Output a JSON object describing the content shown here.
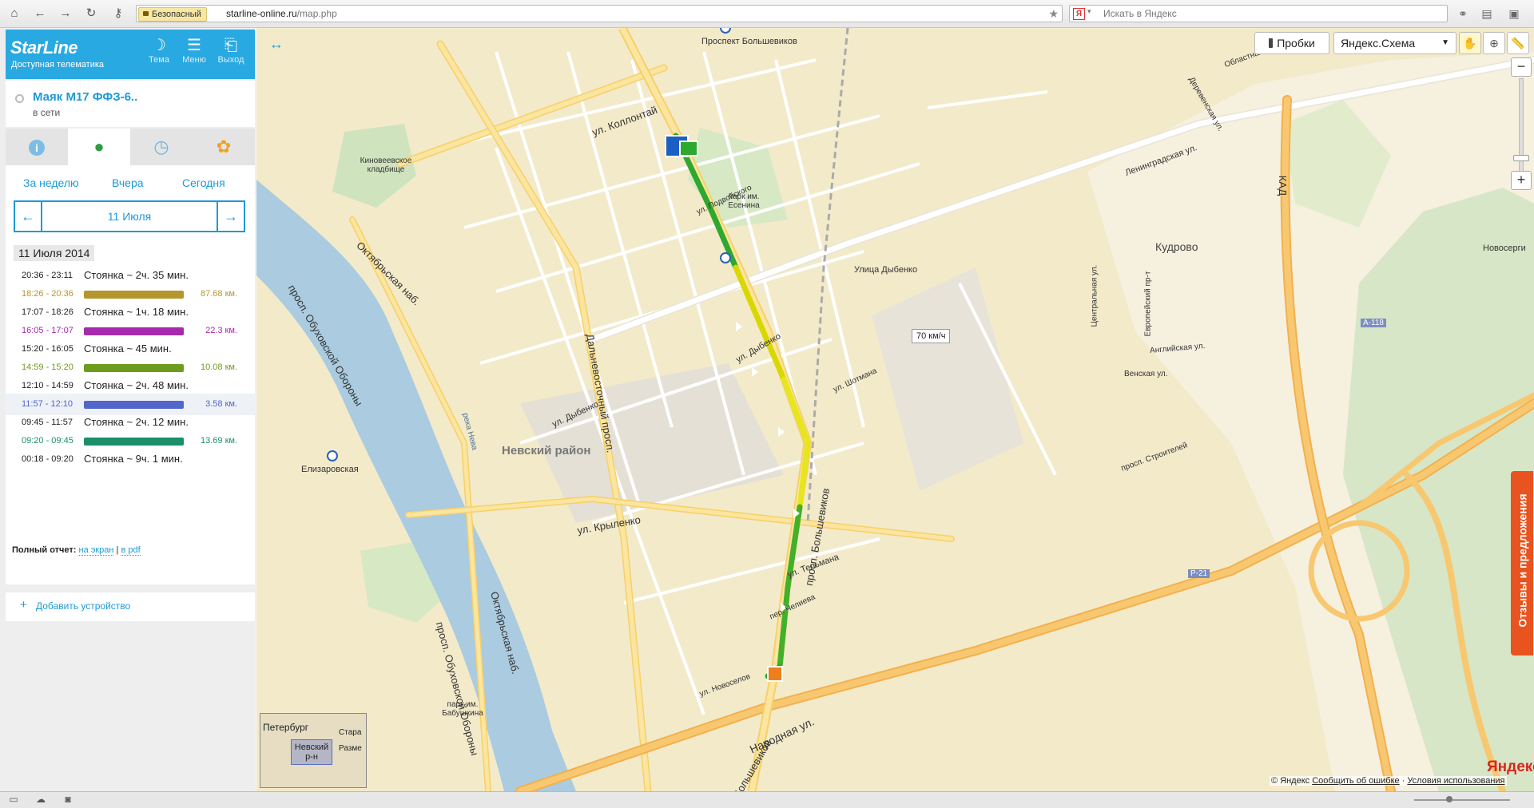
{
  "browser": {
    "secure_label": "Безопасный",
    "url_host": "starline-online.ru",
    "url_path": "/map.php",
    "search_placeholder": "Искать в Яндекс",
    "ya_badge": "Я"
  },
  "header": {
    "logo": "StarLine",
    "tagline": "Доступная телематика",
    "buttons": [
      {
        "label": "Тема",
        "icon": "moon-icon"
      },
      {
        "label": "Меню",
        "icon": "menu-icon"
      },
      {
        "label": "Выход",
        "icon": "exit-icon"
      }
    ]
  },
  "device": {
    "name": "Маяк М17 ФФЗ-6..",
    "status": "в сети"
  },
  "tabs": [
    {
      "name": "info",
      "icon": "info-icon",
      "active": false
    },
    {
      "name": "map",
      "icon": "location-pin-icon",
      "active": true
    },
    {
      "name": "history",
      "icon": "clock-icon",
      "active": false
    },
    {
      "name": "settings",
      "icon": "settings-icon",
      "active": false
    }
  ],
  "period": {
    "week": "За неделю",
    "yesterday": "Вчера",
    "today": "Сегодня",
    "prev_arrow": "←",
    "next_arrow": "→",
    "current_date": "11 Июля"
  },
  "history": {
    "date_title": "11 Июля 2014",
    "trips": [
      {
        "time": "20:36 - 23:11",
        "type": "stop",
        "label": "Стоянка ~ 2ч. 35 мин."
      },
      {
        "time": "18:26 - 20:36",
        "type": "drive",
        "km": "87.68 км.",
        "color": "#b5962d"
      },
      {
        "time": "17:07 - 18:26",
        "type": "stop",
        "label": "Стоянка ~ 1ч. 18 мин."
      },
      {
        "time": "16:05 - 17:07",
        "type": "drive",
        "km": "22.3 км.",
        "color": "#a62aad"
      },
      {
        "time": "15:20 - 16:05",
        "type": "stop",
        "label": "Стоянка ~ 45 мин."
      },
      {
        "time": "14:59 - 15:20",
        "type": "drive",
        "km": "10.08 км.",
        "color": "#6f9b1f"
      },
      {
        "time": "12:10 - 14:59",
        "type": "stop",
        "label": "Стоянка ~ 2ч. 48 мин."
      },
      {
        "time": "11:57 - 12:10",
        "type": "drive",
        "km": "3.58 км.",
        "color": "#5366cc"
      },
      {
        "time": "09:45 - 11:57",
        "type": "stop",
        "label": "Стоянка ~ 2ч. 12 мин."
      },
      {
        "time": "09:20 - 09:45",
        "type": "drive",
        "km": "13.69 км.",
        "color": "#1a8f6a"
      },
      {
        "time": "00:18 - 09:20",
        "type": "stop",
        "label": "Стоянка ~ 9ч. 1 мин."
      }
    ],
    "report_label": "Полный отчет:",
    "report_screen": "на экран",
    "report_sep": "|",
    "report_pdf": "в pdf"
  },
  "add_device": {
    "icon": "+",
    "label": "Добавить устройство"
  },
  "map": {
    "expand_icon": "↔",
    "traffic_button": "Пробки",
    "layer_select": "Яндекс.Схема",
    "speed_label": "70 км/ч",
    "district": "Невский район",
    "labels": {
      "kudrovo": "Кудрово",
      "novosergi": "Новосерги",
      "bolshevikov_station": "Проспект Большевиков",
      "dybenko_station": "Улица Дыбенко",
      "elizarovskaya": "Елизаровская",
      "cemetery": "Киновеевское кладбище",
      "park_esenina": "парк им. Есенина",
      "park_babushkina": "парк им. Бабушкина",
      "kollontai": "ул. Коллонтай",
      "dybenko_st": "ул. Дыбенко",
      "dybenko_st2": "ул. Дыбенко",
      "krylenko": "ул. Крыленко",
      "telmana": "ул. Тельмана",
      "narodnaya": "Народная ул.",
      "dalnevostochny": "Дальневосточный просп.",
      "oktyabrskaya": "Октябрьская наб.",
      "oktyabrskaya2": "Октябрьская наб.",
      "obukhovskoy": "просп. Обуховской Обороны",
      "obukhovskoy2": "просп. Обуховской Обороны",
      "bolshevikov_prosp": "просп. Большевиков",
      "bolshevikov_short": "Большевиков",
      "leningradskaya": "Ленинградская ул.",
      "kad": "КАД",
      "a118": "А-118",
      "p21": "Р-21",
      "neva": "река Нева",
      "podvoiskogo": "ул. Подвойского",
      "shotmana": "ул. Шотмана",
      "novoselov": "ул. Новоселов",
      "chelieva": "пер. Челиева",
      "tsentralnaya": "Центральная ул.",
      "venskaya": "Венская ул.",
      "angliyskaya": "Английская ул.",
      "evropeyskiy": "Европейский пр-т",
      "stroiteley": "просп. Строителей",
      "oblastnaya": "Областная ул.",
      "derevenskaya": "Деревенская ул."
    },
    "minimap": {
      "city": "Петербург",
      "area": "Невский р-н",
      "old": "Стара",
      "razme": "Разме"
    },
    "attribution": {
      "copyright": "© Яндекс",
      "report_error": "Сообщить об ошибке",
      "terms": "Условия использования"
    },
    "yandex_mark": "Яндекс",
    "feedback_tab": "Отзывы и предложения"
  }
}
